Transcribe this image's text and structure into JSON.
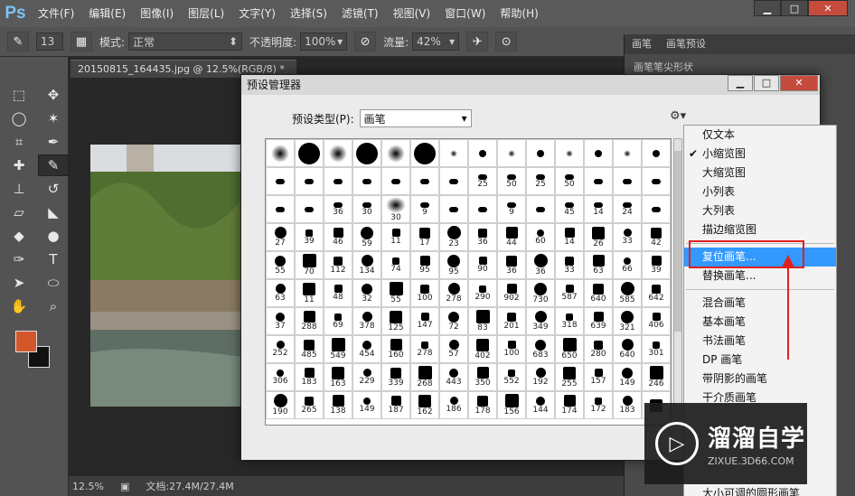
{
  "menubar": {
    "logo": "Ps",
    "items": [
      "文件(F)",
      "编辑(E)",
      "图像(I)",
      "图层(L)",
      "文字(Y)",
      "选择(S)",
      "滤镜(T)",
      "视图(V)",
      "窗口(W)",
      "帮助(H)"
    ]
  },
  "options": {
    "brush_size": "13",
    "mode_label": "模式:",
    "mode_value": "正常",
    "opacity_label": "不透明度:",
    "opacity_value": "100%",
    "flow_label": "流量:",
    "flow_value": "42%"
  },
  "document": {
    "tab_title": "20150815_164435.jpg @ 12.5%(RGB/8) *",
    "zoom": "12.5%",
    "doc_size": "文档:27.4M/27.4M"
  },
  "right_panel": {
    "tabs": [
      "画笔",
      "画笔预设"
    ],
    "sub": "画笔笔尖形状"
  },
  "colors": {
    "foreground": "#d4572c",
    "background": "#111111",
    "highlight": "#3399ff",
    "annotation": "#e02020"
  },
  "dialog": {
    "title": "预设管理器",
    "preset_label": "预设类型(P):",
    "preset_value": "画笔",
    "brush_cells": [
      [
        "",
        "",
        "",
        "",
        "",
        "",
        "",
        "",
        "",
        "",
        "",
        "",
        "",
        ""
      ],
      [
        "",
        "",
        "",
        "",
        "",
        "",
        "",
        "25",
        "50",
        "25",
        "50",
        "",
        "",
        ""
      ],
      [
        "",
        "",
        "36",
        "30",
        "30",
        "9",
        "",
        "",
        "9",
        "",
        "45",
        "14",
        "24",
        ""
      ],
      [
        "27",
        "39",
        "46",
        "59",
        "11",
        "17",
        "23",
        "36",
        "44",
        "60",
        "14",
        "26",
        "33",
        "42"
      ],
      [
        "55",
        "70",
        "112",
        "134",
        "74",
        "95",
        "95",
        "90",
        "36",
        "36",
        "33",
        "63",
        "66",
        "39"
      ],
      [
        "63",
        "11",
        "48",
        "32",
        "55",
        "100",
        "278",
        "290",
        "902",
        "730",
        "587",
        "640",
        "585",
        "642"
      ],
      [
        "37",
        "288",
        "69",
        "378",
        "125",
        "147",
        "72",
        "83",
        "201",
        "349",
        "318",
        "639",
        "321",
        "406"
      ],
      [
        "252",
        "485",
        "549",
        "454",
        "160",
        "278",
        "57",
        "402",
        "100",
        "683",
        "650",
        "280",
        "640",
        "301"
      ],
      [
        "306",
        "183",
        "163",
        "229",
        "339",
        "268",
        "443",
        "350",
        "552",
        "192",
        "255",
        "157",
        "149",
        "246"
      ],
      [
        "190",
        "265",
        "138",
        "149",
        "187",
        "162",
        "186",
        "178",
        "156",
        "144",
        "174",
        "172",
        "183",
        ""
      ]
    ]
  },
  "menu": {
    "items": [
      "仅文本",
      "小缩览图",
      "大缩览图",
      "小列表",
      "大列表",
      "描边缩览图",
      "复位画笔...",
      "替换画笔...",
      "混合画笔",
      "基本画笔",
      "书法画笔",
      "DP 画笔",
      "带阴影的画笔",
      "干介质画笔"
    ],
    "checked": "小缩览图",
    "highlighted": "复位画笔...",
    "bottom_item": "大小可调的圆形画笔"
  },
  "watermark": {
    "brand": "溜溜自学",
    "url": "ZIXUE.3D66.COM"
  }
}
